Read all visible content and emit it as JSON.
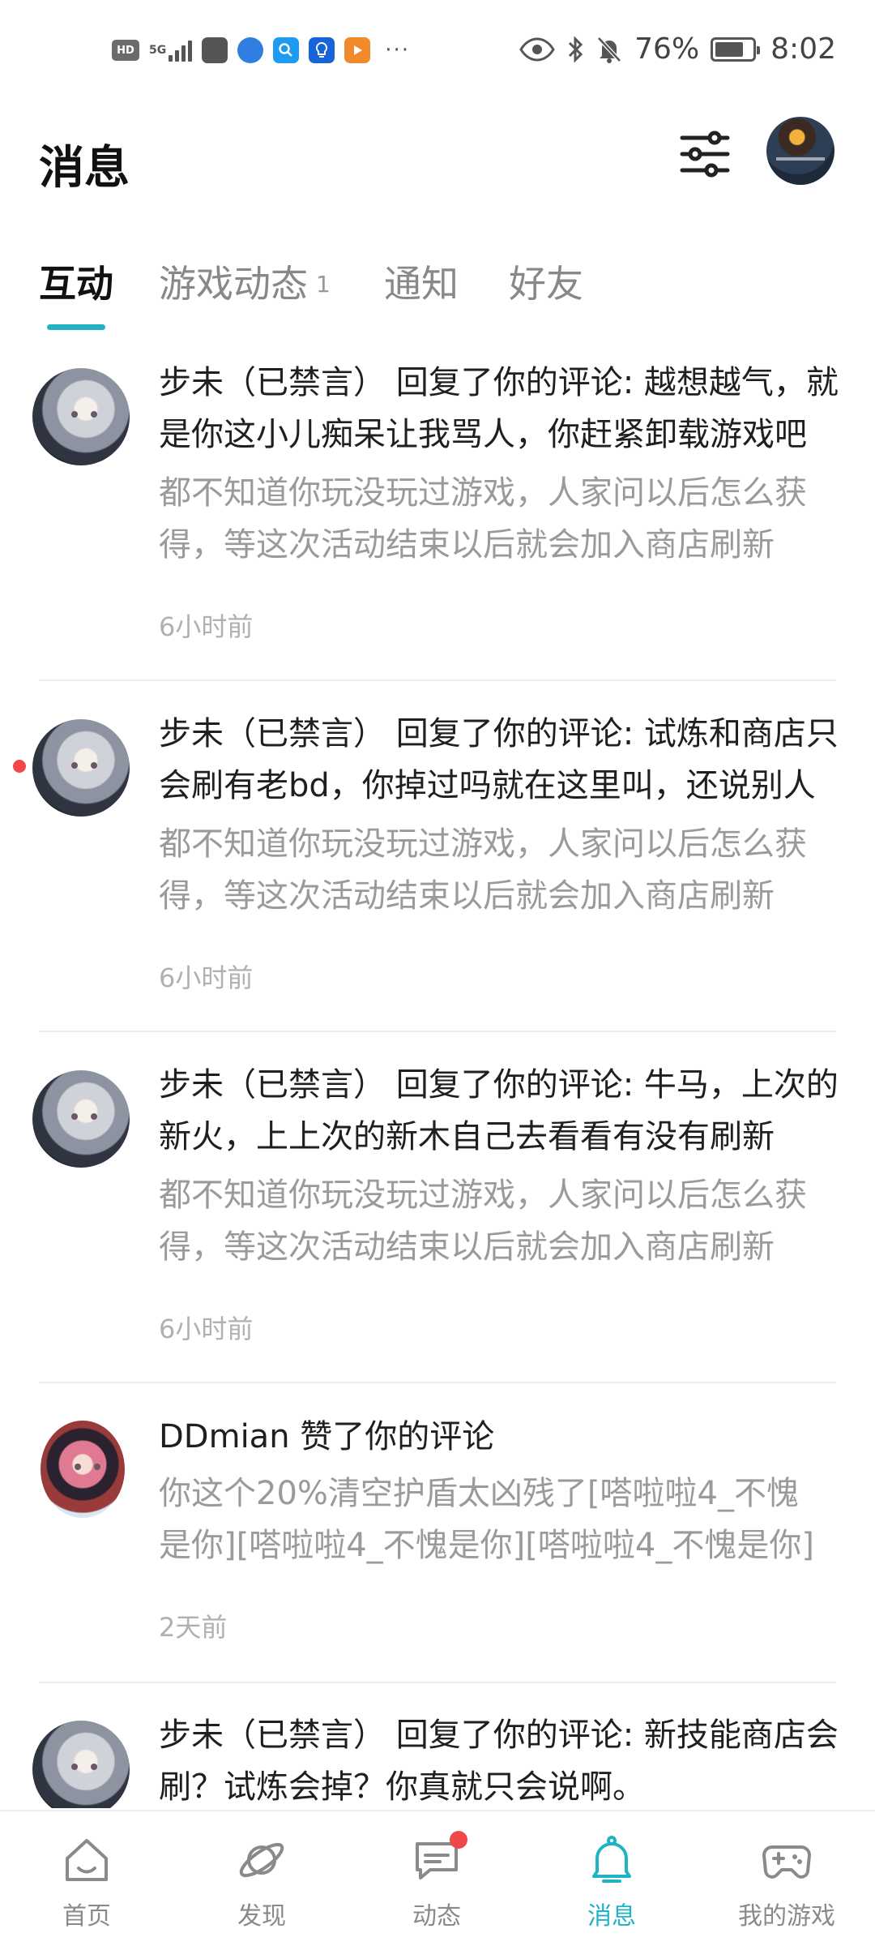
{
  "status_bar": {
    "left_icons": [
      "hd-icon",
      "5g-icon",
      "signal-icon",
      "huawei-app-icon",
      "browser-icon",
      "search-app-icon",
      "bulb-app-icon",
      "video-app-icon"
    ],
    "hd_label": "HD",
    "network_label": "5G",
    "more_indicator": "···",
    "battery_text": "76%",
    "battery_level": 0.76,
    "time": "8:02"
  },
  "header": {
    "title": "消息"
  },
  "tabs": [
    {
      "label": "互动",
      "active": true
    },
    {
      "label": "游戏动态",
      "badge": "1"
    },
    {
      "label": "通知"
    },
    {
      "label": "好友"
    }
  ],
  "messages": [
    {
      "title": "步未（已禁言） 回复了你的评论: 越想越气，就是你这小儿痴呆让我骂人，你赶紧卸载游戏吧",
      "quote": "都不知道你玩没玩过游戏，人家问以后怎么获得，等这次活动结束以后就会加入商店刷新",
      "time": "6小时前",
      "avatar": "silver-hair-avatar",
      "unread": false
    },
    {
      "title": "步未（已禁言） 回复了你的评论: 试炼和商店只会刷有老bd，你掉过吗就在这里叫，还说别人",
      "quote": "都不知道你玩没玩过游戏，人家问以后怎么获得，等这次活动结束以后就会加入商店刷新",
      "time": "6小时前",
      "avatar": "silver-hair-avatar",
      "unread": true
    },
    {
      "title": "步未（已禁言） 回复了你的评论: 牛马，上次的新火，上上次的新木自己去看看有没有刷新",
      "quote": "都不知道你玩没玩过游戏，人家问以后怎么获得，等这次活动结束以后就会加入商店刷新",
      "time": "6小时前",
      "avatar": "silver-hair-avatar",
      "unread": false
    },
    {
      "title": "DDmian 赞了你的评论",
      "quote": "你这个20%清空护盾太凶残了[嗒啦啦4_不愧是你][嗒啦啦4_不愧是你][嗒啦啦4_不愧是你]",
      "time": "2天前",
      "avatar": "pink-hair-avatar",
      "unread": false
    },
    {
      "title": "步未（已禁言） 回复了你的评论: 新技能商店会刷？试炼会掉？你真就只会说啊。",
      "quote": "",
      "time": "",
      "avatar": "silver-hair-avatar",
      "unread": false
    }
  ],
  "bottom_nav": [
    {
      "label": "首页",
      "icon": "home-icon"
    },
    {
      "label": "发现",
      "icon": "planet-icon"
    },
    {
      "label": "动态",
      "icon": "chat-icon",
      "dot": true
    },
    {
      "label": "消息",
      "icon": "bell-icon",
      "active": true
    },
    {
      "label": "我的游戏",
      "icon": "gamepad-icon"
    }
  ],
  "colors": {
    "accent": "#21b3c4",
    "unread": "#f04848",
    "primary_text": "#1f1f1f",
    "secondary_text": "#9a9a9a"
  }
}
